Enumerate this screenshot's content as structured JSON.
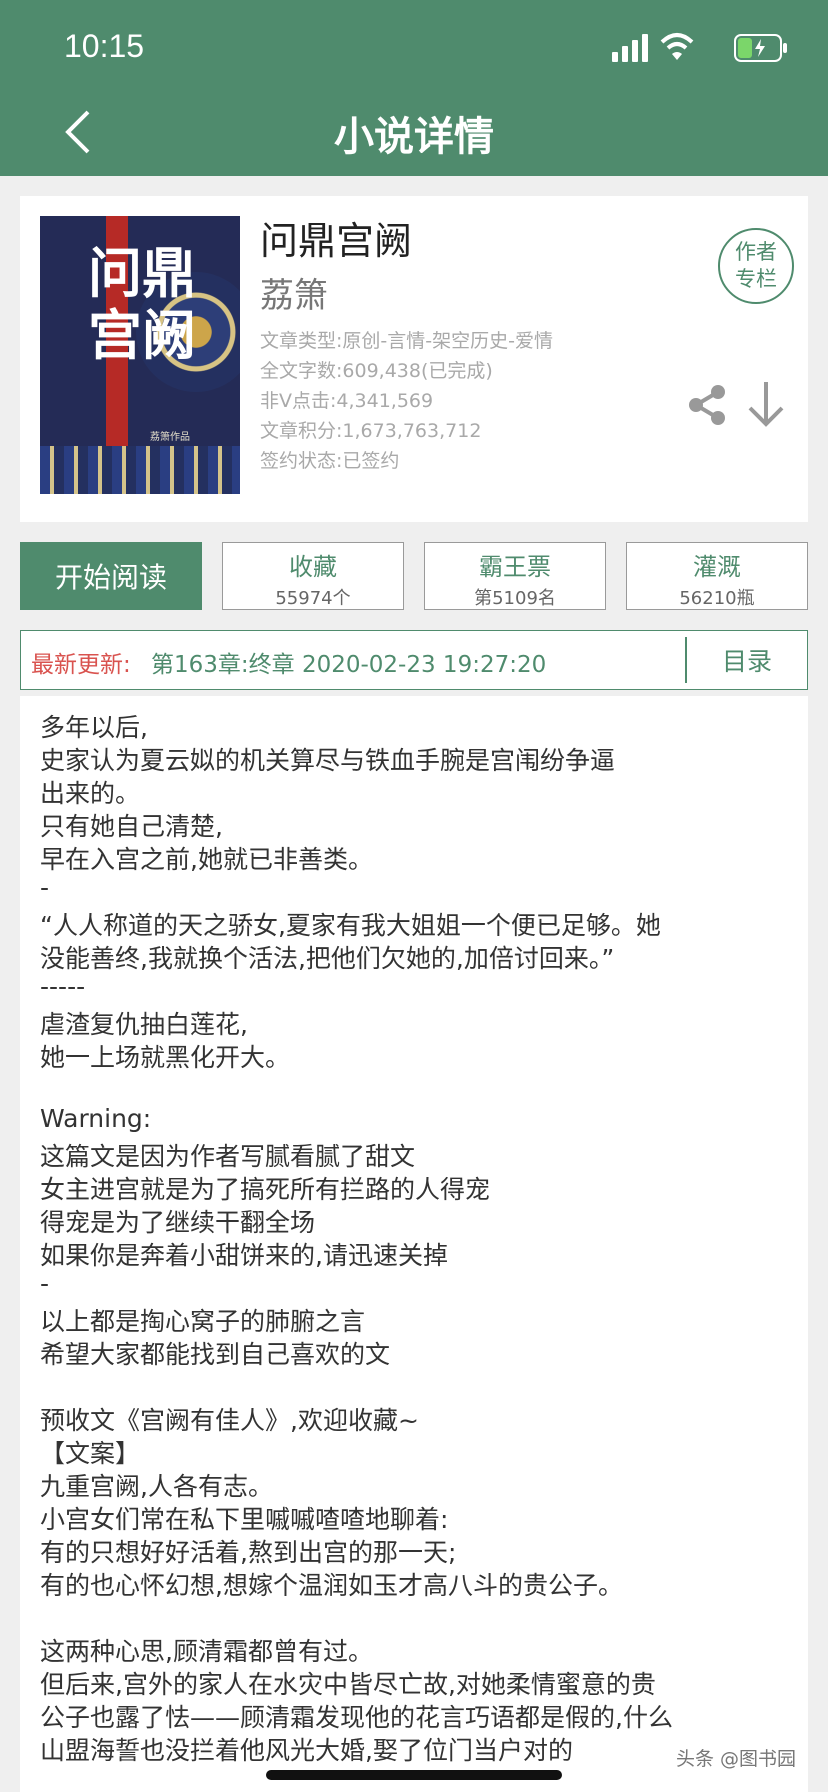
{
  "status": {
    "time": "10:15"
  },
  "header": {
    "title": "小说详情"
  },
  "book": {
    "cover_title": "问鼎宫阙",
    "cover_author": "荔箫作品",
    "title": "问鼎宫阙",
    "author": "荔箫",
    "meta": [
      "文章类型:原创-言情-架空历史-爱情",
      "全文字数:609,438(已完成)",
      "非V点击:4,341,569",
      "文章积分:1,673,763,712",
      "签约状态:已签约"
    ],
    "author_column": [
      "作者",
      "专栏"
    ]
  },
  "actions": {
    "start_reading": "开始阅读",
    "favorite": {
      "label": "收藏",
      "value": "55974个"
    },
    "overlord": {
      "label": "霸王票",
      "value": "第5109名"
    },
    "nutrition": {
      "label": "灌溉",
      "value": "56210瓶"
    }
  },
  "update": {
    "label": "最新更新:",
    "chapter": "第163章:终章 2020-02-23 19:27:20",
    "catalog": "目录"
  },
  "description": [
    "多年以后,",
    "史家认为夏云姒的机关算尽与铁血手腕是宫闱纷争逼",
    "出来的。",
    "只有她自己清楚,",
    "早在入宫之前,她就已非善类。",
    "-",
    "“人人称道的天之骄女,夏家有我大姐姐一个便已足够。她",
    "没能善终,我就换个活法,把他们欠她的,加倍讨回来。”",
    "-----",
    "虐渣复仇抽白莲花,",
    "她一上场就黑化开大。",
    "",
    "Warning:",
    "这篇文是因为作者写腻看腻了甜文",
    "女主进宫就是为了搞死所有拦路的人得宠",
    "得宠是为了继续干翻全场",
    "如果你是奔着小甜饼来的,请迅速关掉",
    "-",
    "以上都是掏心窝子的肺腑之言",
    "希望大家都能找到自己喜欢的文",
    "",
    "预收文《宫阙有佳人》,欢迎收藏~",
    "【文案】",
    "九重宫阙,人各有志。",
    "小宫女们常在私下里嘁嘁喳喳地聊着:",
    "有的只想好好活着,熬到出宫的那一天;",
    "有的也心怀幻想,想嫁个温润如玉才高八斗的贵公子。",
    "",
    "这两种心思,顾清霜都曾有过。",
    "但后来,宫外的家人在水灾中皆尽亡故,对她柔情蜜意的贵",
    "公子也露了怯——顾清霜发现他的花言巧语都是假的,什么",
    "山盟海誓也没拦着他风光大婚,娶了位门当户对的"
  ],
  "watermark": "头条 @图书园"
}
